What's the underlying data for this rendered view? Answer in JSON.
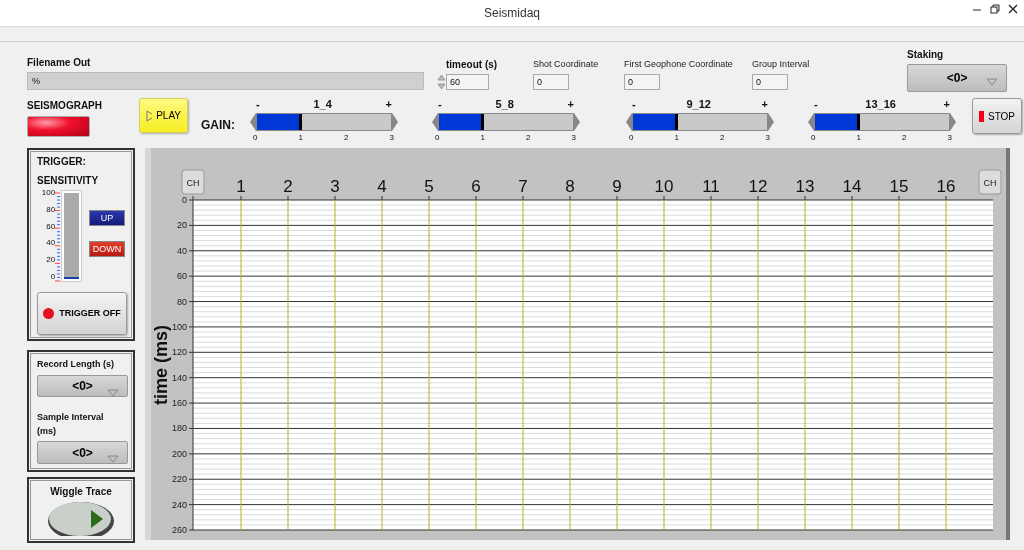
{
  "window": {
    "title": "Seismidaq"
  },
  "filename_out": {
    "label": "Filename Out",
    "value": "%"
  },
  "timeout": {
    "label": "timeout (s)",
    "value": "60"
  },
  "coordinates": [
    {
      "label": "Shot Coordinate",
      "value": "0"
    },
    {
      "label": "First Geophone Coordinate",
      "value": "0"
    },
    {
      "label": "Group Interval",
      "value": "0"
    }
  ],
  "staking": {
    "label": "Staking",
    "value": "<0>"
  },
  "seismograph": {
    "label": "SEISMOGRAPH",
    "on": true
  },
  "play_button": {
    "label": "PLAY"
  },
  "gain": {
    "label": "GAIN:",
    "sliders": [
      {
        "name": "1_4",
        "minus": "-",
        "plus": "+",
        "level": 0.333,
        "ticks": [
          "0",
          "1",
          "2",
          "3"
        ]
      },
      {
        "name": "5_8",
        "minus": "-",
        "plus": "+",
        "level": 0.333,
        "ticks": [
          "0",
          "1",
          "2",
          "3"
        ]
      },
      {
        "name": "9_12",
        "minus": "-",
        "plus": "+",
        "level": 0.333,
        "ticks": [
          "0",
          "1",
          "2",
          "3"
        ]
      },
      {
        "name": "13_16",
        "minus": "-",
        "plus": "+",
        "level": 0.333,
        "ticks": [
          "0",
          "1",
          "2",
          "3"
        ]
      }
    ]
  },
  "stop_button": {
    "label": "STOP"
  },
  "trigger": {
    "title": "TRIGGER:",
    "subtitle": "SENSITIVITY",
    "scale": [
      "100",
      "80",
      "60",
      "40",
      "20",
      "0"
    ],
    "level": 0,
    "up": "UP",
    "down": "DOWN",
    "button": "TRIGGER OFF"
  },
  "record_length": {
    "label": "Record Length (s)",
    "value": "<0>"
  },
  "sample_interval": {
    "label": "Sample Interval (ms)",
    "value": "<0>"
  },
  "wiggle_trace": {
    "label": "Wiggle Trace"
  },
  "graph": {
    "ch_buttons": [
      "CH",
      "CH"
    ],
    "channels": [
      "1",
      "2",
      "3",
      "4",
      "5",
      "6",
      "7",
      "8",
      "9",
      "10",
      "11",
      "12",
      "13",
      "14",
      "15",
      "16"
    ],
    "ylabel": "time (ms)",
    "yticks": [
      "0",
      "20",
      "40",
      "60",
      "80",
      "100",
      "120",
      "140",
      "160",
      "180",
      "200",
      "220",
      "240",
      "260"
    ]
  }
}
